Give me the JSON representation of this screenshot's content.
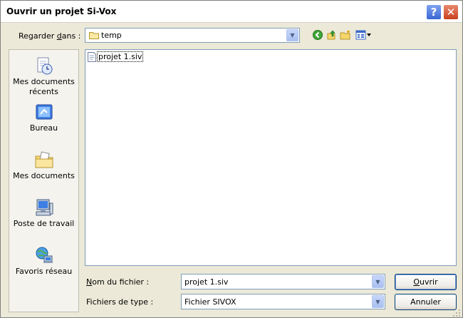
{
  "window": {
    "title": "Ouvrir un projet Si-Vox",
    "help_label": "?",
    "close_label": "✕"
  },
  "lookin": {
    "label_pre": "Regarder ",
    "label_key": "d",
    "label_post": "ans :",
    "value": "temp"
  },
  "places": [
    {
      "label": "Mes documents récents",
      "icon": "recent-documents-icon"
    },
    {
      "label": "Bureau",
      "icon": "desktop-icon"
    },
    {
      "label": "Mes documents",
      "icon": "my-documents-icon"
    },
    {
      "label": "Poste de travail",
      "icon": "my-computer-icon"
    },
    {
      "label": "Favoris réseau",
      "icon": "network-places-icon"
    }
  ],
  "files": [
    {
      "name": "projet 1.siv"
    }
  ],
  "filename": {
    "label_key": "N",
    "label_post": "om du fichier :",
    "value": "projet 1.siv"
  },
  "filetype": {
    "label": "Fichiers de type :",
    "value": "Fichier SIVOX"
  },
  "buttons": {
    "open_key": "O",
    "open_post": "uvrir",
    "cancel": "Annuler"
  },
  "colors": {
    "dialog_bg": "#ece9d8",
    "field_border": "#7f9db9",
    "button_border": "#003c74"
  }
}
